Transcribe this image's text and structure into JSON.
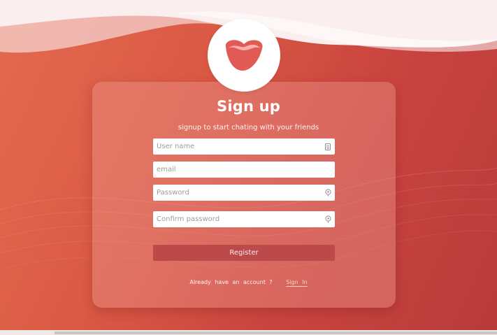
{
  "colors": {
    "accent": "#bd4a4b",
    "background_start": "#e46a4f",
    "background_end": "#b83b3a",
    "wave_light": "#fcefee",
    "field_bg": "#ffffff"
  },
  "logo": {
    "icon": "heart-blob-icon"
  },
  "form": {
    "title": "Sign up",
    "subtitle": "signup to start chating with your friends",
    "fields": [
      {
        "placeholder": "User name",
        "value": "",
        "icon": "id-card-icon"
      },
      {
        "placeholder": "email",
        "value": "",
        "icon": ""
      },
      {
        "placeholder": "Password",
        "value": "",
        "icon": "lock-icon"
      },
      {
        "placeholder": "Confirm password",
        "value": "",
        "icon": "lock-icon"
      }
    ],
    "register_label": "Register",
    "account_prompt": "Already have an account ?",
    "signin_label": "Sign In"
  }
}
